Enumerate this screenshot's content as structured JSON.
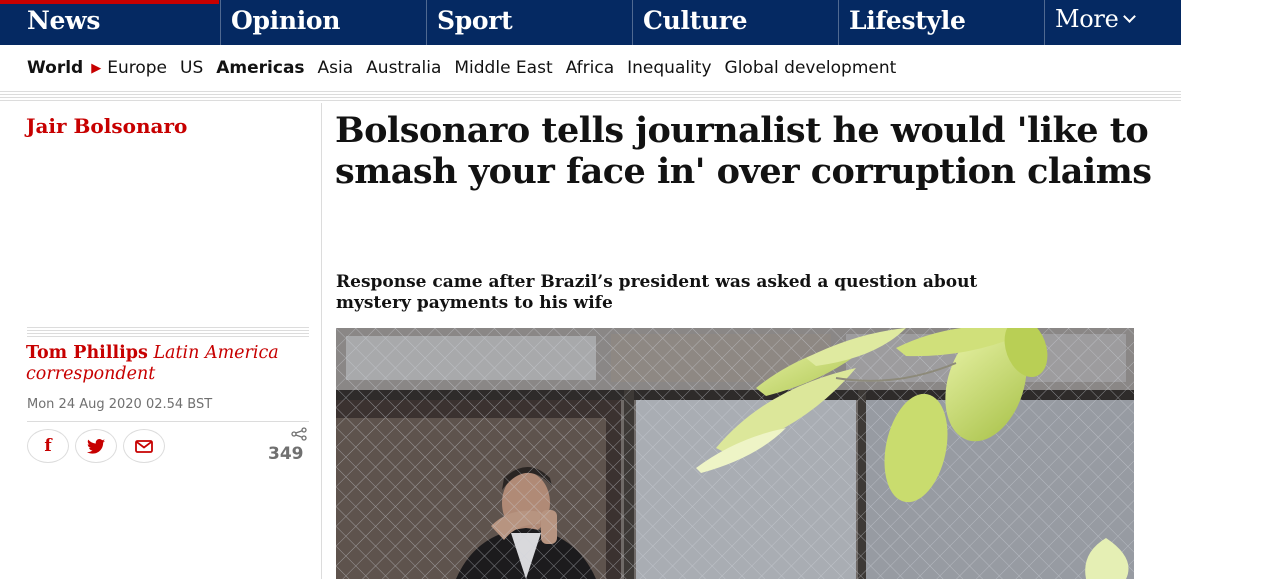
{
  "top_nav": {
    "pillars": [
      {
        "label": "News",
        "color": "#c70000"
      },
      {
        "label": "Opinion",
        "color": "#e05e00"
      },
      {
        "label": "Sport",
        "color": "#0084c6"
      },
      {
        "label": "Culture",
        "color": "#a1845c"
      },
      {
        "label": "Lifestyle",
        "color": "#bb3b80"
      }
    ],
    "more_label": "More"
  },
  "sub_nav": {
    "items": [
      "World",
      "Europe",
      "US",
      "Americas",
      "Asia",
      "Australia",
      "Middle East",
      "Africa",
      "Inequality",
      "Global development"
    ],
    "active": "Americas"
  },
  "article": {
    "series": "Jair Bolsonaro",
    "headline": "Bolsonaro tells journalist he would 'like to smash your face in' over corruption claims",
    "standfirst": "Response came after Brazil’s president was asked a question about mystery payments to his wife",
    "byline_name": "Tom Phillips",
    "byline_role": "Latin America correspondent",
    "date": "Mon 24 Aug 2020 02.54 BST",
    "share_buttons": [
      "facebook-icon",
      "twitter-icon",
      "email-icon"
    ],
    "share_count": "349"
  },
  "colors": {
    "nav_bg": "#052962",
    "accent_red": "#c70000"
  }
}
